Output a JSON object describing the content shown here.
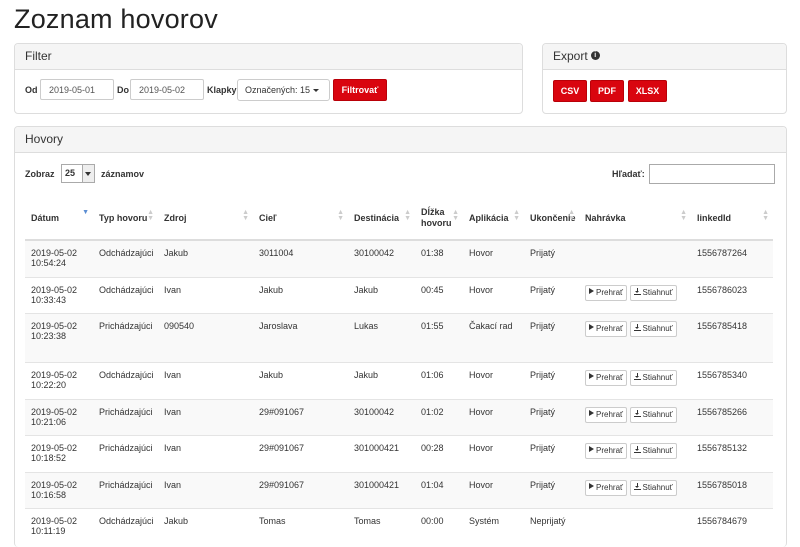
{
  "page": {
    "title": "Zoznam hovorov"
  },
  "filter": {
    "title": "Filter",
    "from_label": "Od",
    "from_value": "2019-05-01",
    "to_label": "Do",
    "to_value": "2019-05-02",
    "keys_label": "Klapky",
    "keys_value": "Označených: 15",
    "submit_label": "Filtrovať"
  },
  "export": {
    "title": "Export",
    "buttons": [
      "CSV",
      "PDF",
      "XLSX"
    ]
  },
  "calls": {
    "title": "Hovory",
    "show_label": "Zobraz",
    "page_length": "25",
    "records_label": "záznamov",
    "search_label": "Hľadať:",
    "columns": [
      "Dátum",
      "Typ hovoru",
      "Zdroj",
      "Cieľ",
      "Destinácia",
      "Dĺžka hovoru",
      "Aplikácia",
      "Ukončenie",
      "Nahrávka",
      "linkedId"
    ],
    "play_label": "Prehrať",
    "download_label": "Stiahnuť",
    "rows": [
      {
        "date": "2019-05-02",
        "time": "10:54:24",
        "type": "Odchádzajúci",
        "source": "Jakub",
        "target": "3011004",
        "destination": "30100042",
        "duration": "01:38",
        "app": "Hovor",
        "end": "Prijatý",
        "recording": false,
        "linked": "1556787264"
      },
      {
        "date": "2019-05-02",
        "time": "10:33:43",
        "type": "Odchádzajúci",
        "source": "Ivan",
        "target": "Jakub",
        "destination": "Jakub",
        "duration": "00:45",
        "app": "Hovor",
        "end": "Prijatý",
        "recording": true,
        "linked": "1556786023"
      },
      {
        "date": "2019-05-02",
        "time": "10:23:38",
        "type": "Prichádzajúci",
        "source": "090540",
        "target": "Jaroslava",
        "destination": "Lukas",
        "duration": "01:55",
        "app": "Čakací rad",
        "end": "Prijatý",
        "recording": true,
        "linked": "1556785418"
      },
      {
        "date": "2019-05-02",
        "time": "10:22:20",
        "type": "Odchádzajúci",
        "source": "Ivan",
        "target": "Jakub",
        "destination": "Jakub",
        "duration": "01:06",
        "app": "Hovor",
        "end": "Prijatý",
        "recording": true,
        "linked": "1556785340"
      },
      {
        "date": "2019-05-02",
        "time": "10:21:06",
        "type": "Prichádzajúci",
        "source": "Ivan",
        "target": "29#091067",
        "destination": "30100042",
        "duration": "01:02",
        "app": "Hovor",
        "end": "Prijatý",
        "recording": true,
        "linked": "1556785266"
      },
      {
        "date": "2019-05-02",
        "time": "10:18:52",
        "type": "Prichádzajúci",
        "source": "Ivan",
        "target": "29#091067",
        "destination": "301000421",
        "duration": "00:28",
        "app": "Hovor",
        "end": "Prijatý",
        "recording": true,
        "linked": "1556785132"
      },
      {
        "date": "2019-05-02",
        "time": "10:16:58",
        "type": "Prichádzajúci",
        "source": "Ivan",
        "target": "29#091067",
        "destination": "301000421",
        "duration": "01:04",
        "app": "Hovor",
        "end": "Prijatý",
        "recording": true,
        "linked": "1556785018"
      },
      {
        "date": "2019-05-02",
        "time": "10:11:19",
        "type": "Odchádzajúci",
        "source": "Jakub",
        "target": "Tomas",
        "destination": "Tomas",
        "duration": "00:00",
        "app": "Systém",
        "end": "Neprijatý",
        "recording": false,
        "linked": "1556784679"
      }
    ]
  },
  "colors": {
    "accent_red": "#d9050f",
    "sort_active": "#5b8ed3"
  }
}
